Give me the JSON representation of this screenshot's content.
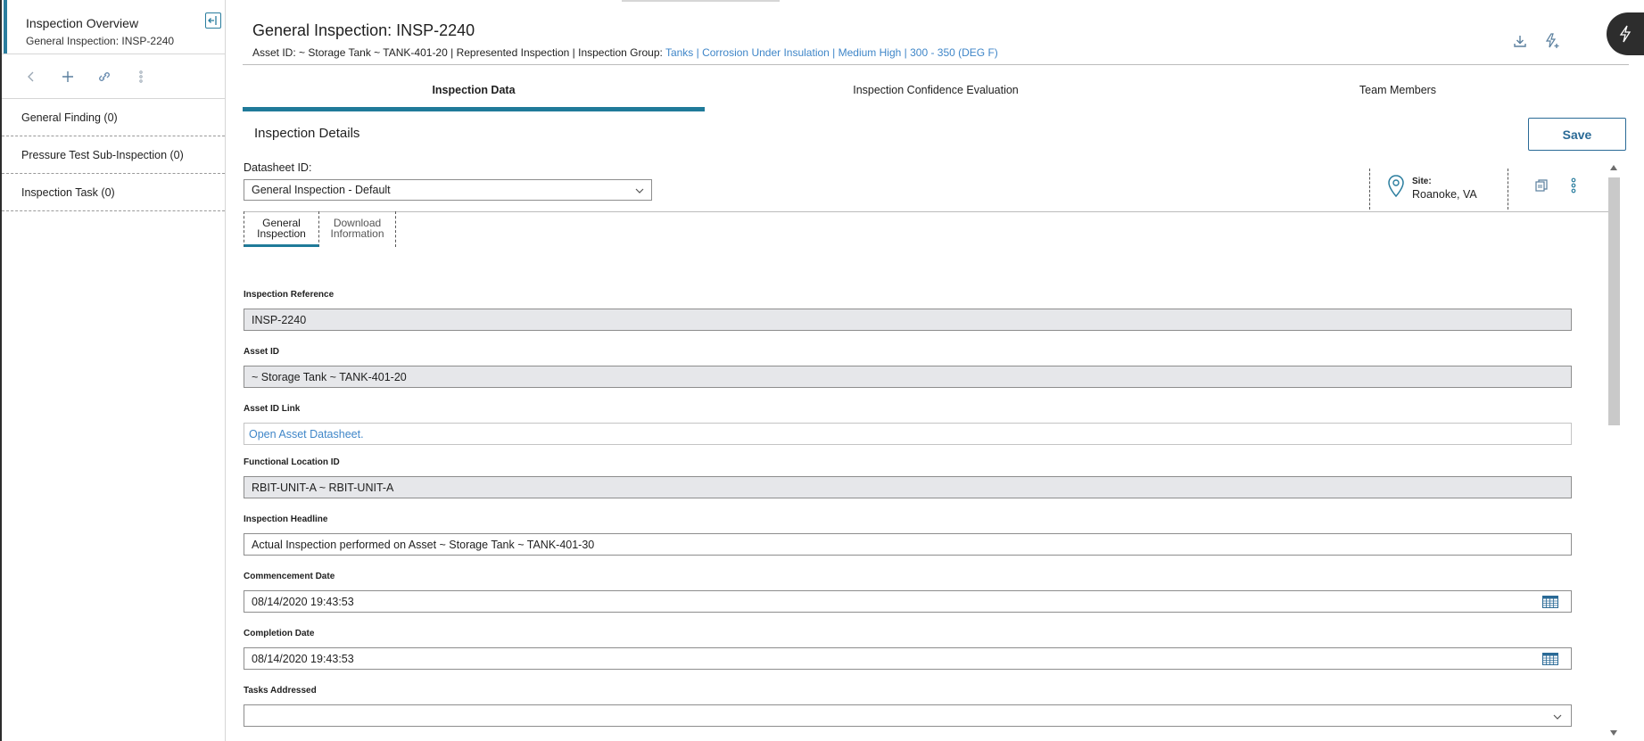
{
  "sidebar": {
    "title": "Inspection Overview",
    "subtitle": "General Inspection: INSP-2240",
    "items": [
      {
        "label": "General Finding (0)"
      },
      {
        "label": "Pressure Test Sub-Inspection (0)"
      },
      {
        "label": "Inspection Task (0)"
      }
    ]
  },
  "header": {
    "title": "General Inspection: INSP-2240",
    "subline_prefix": "Asset ID: ~ Storage Tank ~ TANK-401-20 | Represented Inspection | Inspection Group:",
    "subline_link": "Tanks | Corrosion Under Insulation | Medium High | 300 - 350 (DEG F)"
  },
  "tabs": [
    {
      "label": "Inspection Data",
      "active": true
    },
    {
      "label": "Inspection Confidence Evaluation",
      "active": false
    },
    {
      "label": "Team Members",
      "active": false
    }
  ],
  "section": {
    "title": "Inspection Details",
    "save_label": "Save"
  },
  "datasheet": {
    "label": "Datasheet ID:",
    "value": "General Inspection - Default"
  },
  "site": {
    "label": "Site:",
    "value": "Roanoke, VA"
  },
  "subtabs": [
    {
      "line1": "General",
      "line2": "Inspection",
      "active": true
    },
    {
      "line1": "Download",
      "line2": "Information",
      "active": false
    }
  ],
  "fields": {
    "inspection_reference": {
      "label": "Inspection Reference",
      "value": "INSP-2240"
    },
    "asset_id": {
      "label": "Asset ID",
      "value": " ~ Storage Tank ~ TANK-401-20"
    },
    "asset_id_link": {
      "label": "Asset ID Link",
      "value": "Open Asset Datasheet."
    },
    "functional_location": {
      "label": "Functional Location ID",
      "value": "RBIT-UNIT-A ~ RBIT-UNIT-A"
    },
    "inspection_headline": {
      "label": "Inspection Headline",
      "value": "Actual Inspection performed on Asset  ~ Storage Tank ~ TANK-401-30"
    },
    "commencement_date": {
      "label": "Commencement Date",
      "value": "08/14/2020 19:43:53"
    },
    "completion_date": {
      "label": "Completion Date",
      "value": "08/14/2020 19:43:53"
    },
    "tasks_addressed": {
      "label": "Tasks Addressed",
      "value": ""
    }
  },
  "colors": {
    "accent": "#1f7a99",
    "link": "#3f86c8",
    "readonly_bg": "#e6e7ea"
  },
  "icons": {
    "collapse": "collapse-panel-icon",
    "back": "chevron-left-icon",
    "add": "plus-icon",
    "link": "link-icon",
    "more": "more-vertical-icon",
    "download": "download-icon",
    "flash_add": "flash-plus-icon",
    "assistant": "lightning-icon",
    "location": "location-pin-icon",
    "copy": "copy-document-icon",
    "calendar": "calendar-icon",
    "dropdown": "chevron-down-icon"
  }
}
